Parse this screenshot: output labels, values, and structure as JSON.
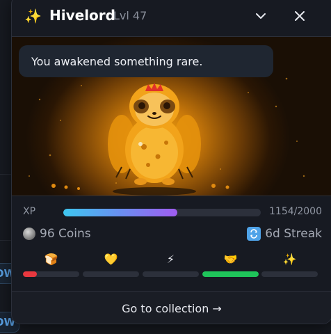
{
  "background": {
    "chip_labels": [
      "OW",
      "OW"
    ]
  },
  "header": {
    "sparkle": "✨",
    "name": "Hivelord",
    "level": "Lvl 47"
  },
  "hero": {
    "message": "You awakened something rare."
  },
  "xp": {
    "label": "XP",
    "value_text": "1154/2000",
    "current": 1154,
    "max": 2000
  },
  "stats": {
    "coins_text": "96 Coins",
    "streak_text": "6d Streak"
  },
  "meters": [
    {
      "emoji": "🍞",
      "level": 0.25,
      "color": "#e8383f"
    },
    {
      "emoji": "💛",
      "level": 0.0,
      "color": "#e0b23a"
    },
    {
      "emoji": "⚡",
      "level": 0.0,
      "color": "#e6d23a"
    },
    {
      "emoji": "🤝",
      "level": 1.0,
      "color": "#1fc45a"
    },
    {
      "emoji": "✨",
      "level": 0.0,
      "color": "#c0a0ff"
    }
  ],
  "footer": {
    "label": "Go to collection →"
  },
  "colors": {
    "accent_start": "#3ec6ef",
    "accent_end": "#a05cf0",
    "hero_glow": "#f2a30e"
  }
}
